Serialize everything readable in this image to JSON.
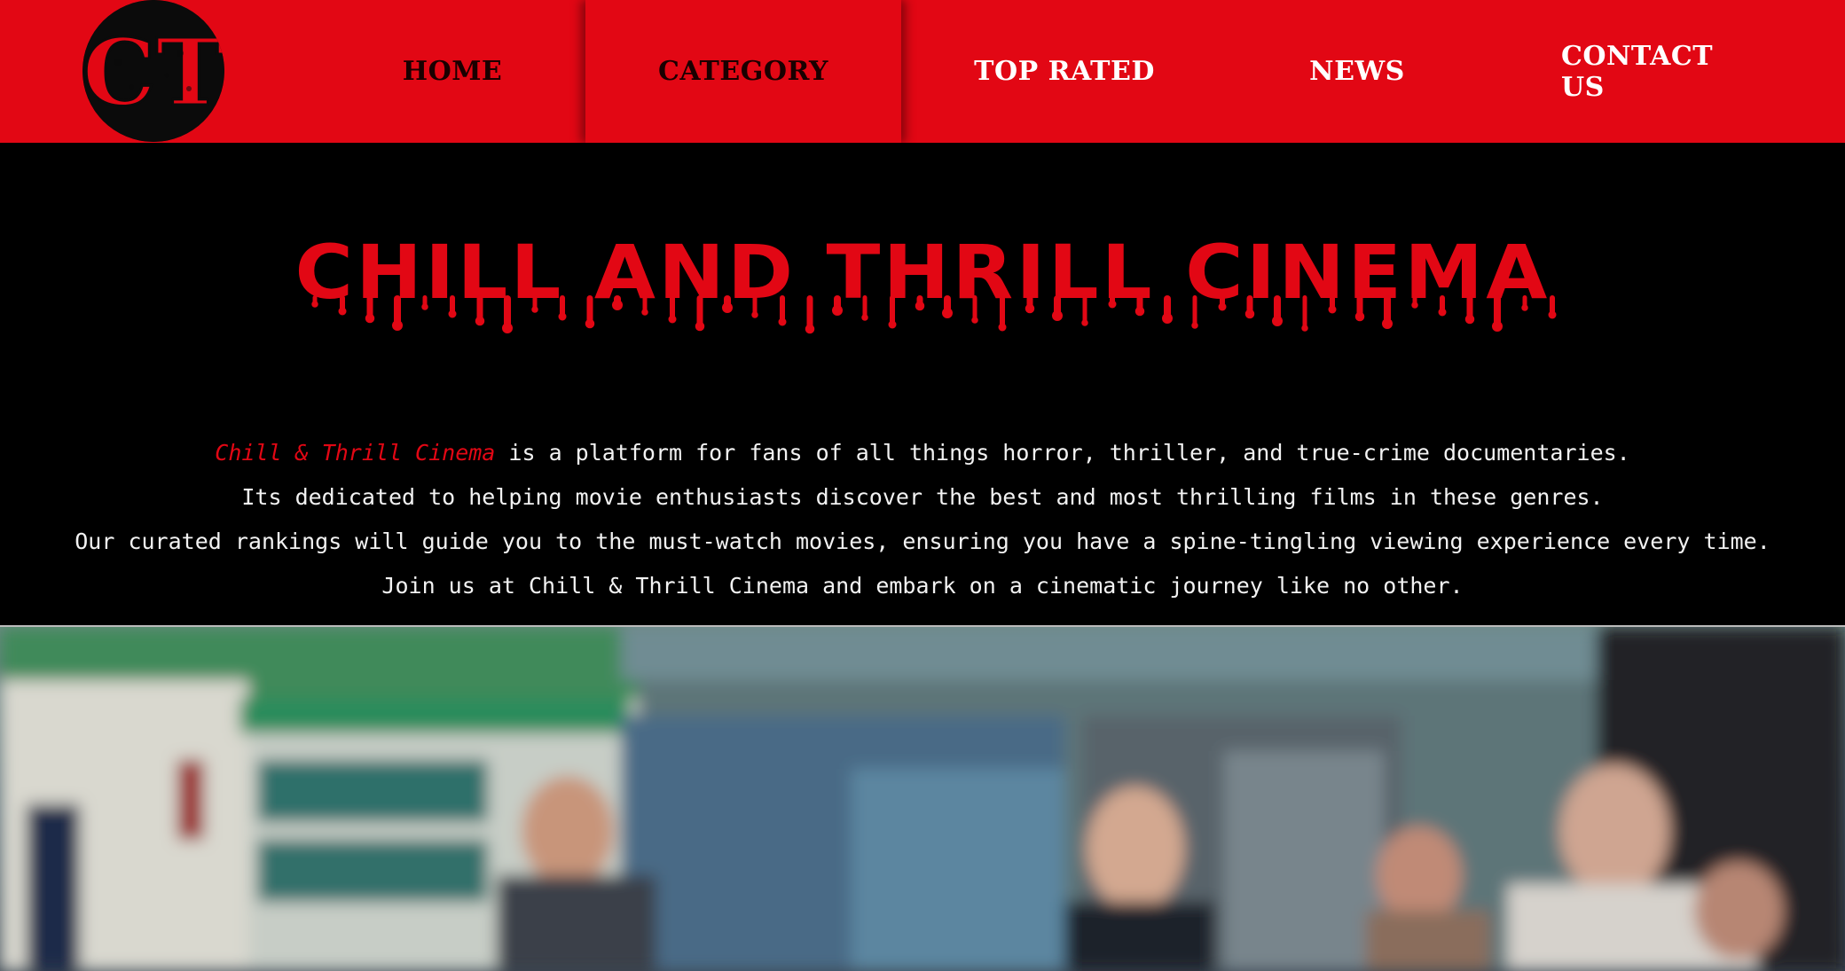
{
  "nav": {
    "logo_text": "CT",
    "logo_icon": "ct-logo-icon",
    "items": [
      {
        "label": "HOME"
      },
      {
        "label": "CATEGORY"
      },
      {
        "label": "TOP RATED"
      },
      {
        "label": "NEWS"
      },
      {
        "label": "CONTACT US"
      }
    ]
  },
  "hero": {
    "title": "CHILL AND THRILL CINEMA",
    "intro": {
      "brand": "Chill & Thrill Cinema",
      "line1_rest": " is a platform for fans of all things horror, thriller, and true-crime documentaries.",
      "line2": "Its dedicated to helping movie enthusiasts discover the best and most thrilling films in these genres.",
      "line3": "Our curated rankings will guide you to the must-watch movies, ensuring you have a spine-tingling viewing experience every time.",
      "line4": "Join us at Chill & Thrill Cinema and embark on a cinematic journey like no other."
    }
  },
  "colors": {
    "brand_red": "#e20714",
    "background": "#000000",
    "body_text": "#f2f2f2",
    "nav_dark_text": "#1a0000",
    "nav_light_text": "#ffffff"
  },
  "image": {
    "name": "movie-still-image"
  }
}
